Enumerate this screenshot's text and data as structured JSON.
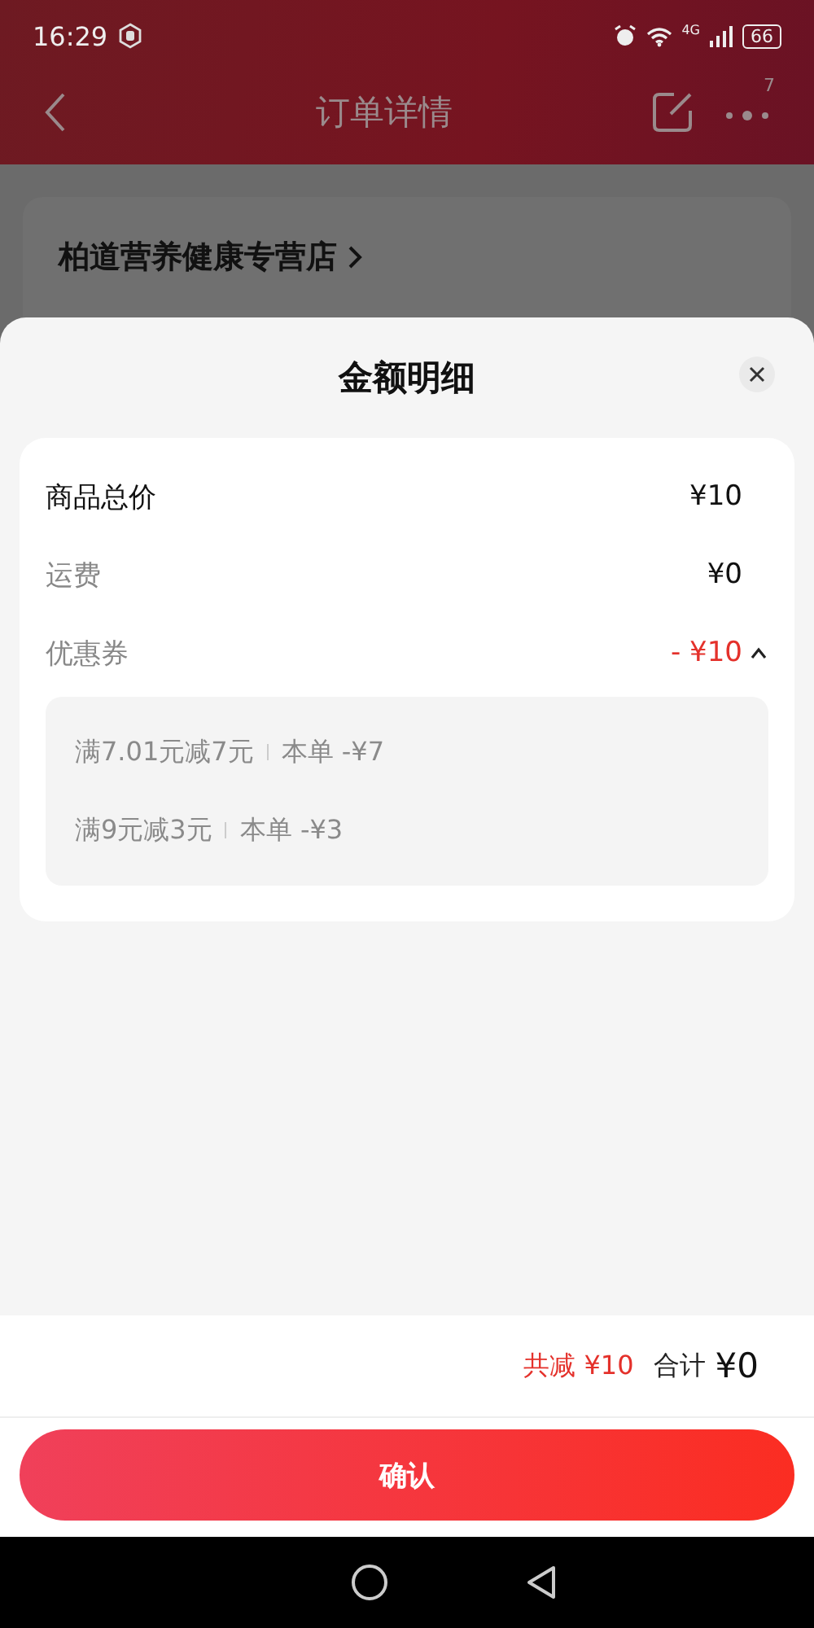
{
  "status_bar": {
    "time": "16:29",
    "network": "4G",
    "battery": "66"
  },
  "header": {
    "title": "订单详情",
    "badge": "7"
  },
  "store": {
    "name": "柏道营养健康专营店"
  },
  "sheet": {
    "title": "金额明细",
    "rows": [
      {
        "kind": "total",
        "label": "商品总价",
        "value": "¥10"
      },
      {
        "kind": "plain",
        "label": "运费",
        "value": "¥0"
      },
      {
        "kind": "discount",
        "label": "优惠券",
        "value": "- ¥10",
        "expanded": true
      }
    ],
    "coupons": [
      {
        "rule": "满7.01元减7元",
        "amount": "本单 -¥7"
      },
      {
        "rule": "满9元减3元",
        "amount": "本单 -¥3"
      }
    ]
  },
  "summary": {
    "discount": "共减 ¥10",
    "total_label": "合计",
    "total": "¥0"
  },
  "confirm": "确认"
}
